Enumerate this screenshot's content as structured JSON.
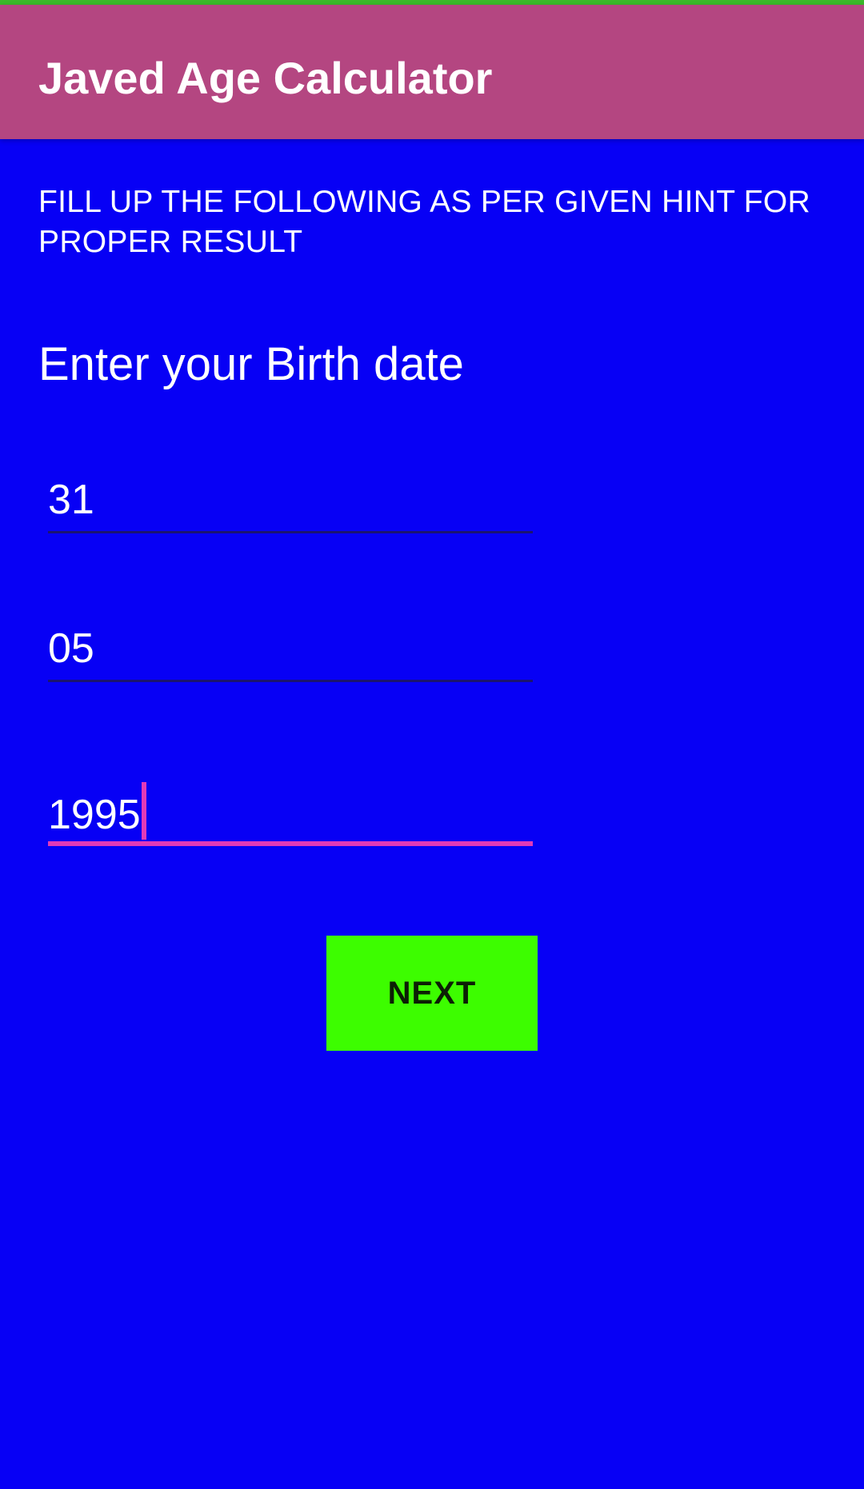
{
  "app_bar": {
    "title": "Javed Age Calculator"
  },
  "main": {
    "hint": "FILL UP THE FOLLOWING AS PER GIVEN HINT FOR PROPER RESULT",
    "section_label": "Enter your Birth date",
    "fields": {
      "day": {
        "value": "31"
      },
      "month": {
        "value": "05"
      },
      "year": {
        "value": "1995",
        "focused": true
      }
    },
    "next_label": "NEXT"
  },
  "colors": {
    "background": "#0700f5",
    "app_bar": "#b44681",
    "status_strip": "#3bb92a",
    "accent": "#e13ab8",
    "button": "#3dfd00",
    "text": "#ffffff"
  }
}
